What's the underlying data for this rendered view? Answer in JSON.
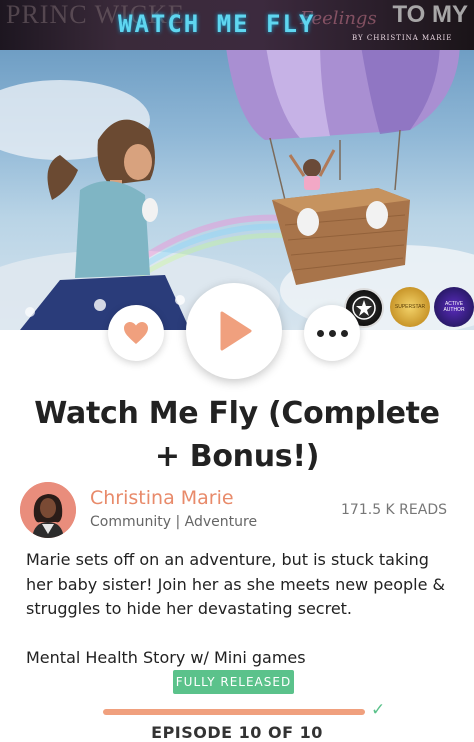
{
  "banner": {
    "title": "WATCH ME FLY",
    "byline": "BY CHRISTINA MARIE",
    "left_text": "PRINC WICKE",
    "right_text": "TO MY",
    "mid_text": "Feelings"
  },
  "badges": [
    {
      "text": ""
    },
    {
      "text": "SUPERSTAR"
    },
    {
      "text": "ACTIVE AUTHOR"
    }
  ],
  "story": {
    "title": "Watch Me Fly (Complete + Bonus!)",
    "author": "Christina Marie",
    "genres": "Community | Adventure",
    "reads": "171.5 K READS",
    "description": [
      "Marie sets off on an adventure, but is stuck taking her baby sister! Join her as she meets new people & struggles to hide her devastating secret.",
      "Mental Health Story w/ Mini games"
    ],
    "status": "FULLY RELEASED",
    "progress": 1.0,
    "episode_label": "EPISODE 10 OF 10"
  },
  "colors": {
    "accent": "#e88a6a",
    "status_green": "#5bc28b",
    "banner_title": "#5fd6f0"
  },
  "icons": {
    "like": "heart-icon",
    "play": "play-icon",
    "more": "more-dots-icon",
    "check": "check-icon"
  }
}
